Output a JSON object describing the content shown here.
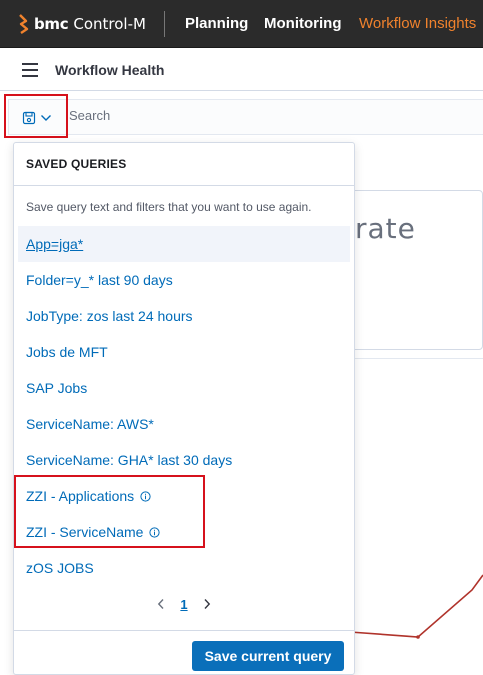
{
  "topbar": {
    "brand_name": "bmc",
    "product_name": "Control-M",
    "nav_items": [
      "Planning",
      "Monitoring",
      "Workflow Insights"
    ],
    "active_nav": "Workflow Insights",
    "accent_color": "#f0822d"
  },
  "header": {
    "title": "Workflow Health",
    "menu_icon": "hamburger-icon"
  },
  "search": {
    "placeholder": "Search",
    "query_menu_icon": "save-query-icon"
  },
  "background": {
    "panel_text": "rate"
  },
  "saved_queries": {
    "title": "SAVED QUERIES",
    "description": "Save query text and filters that you want to use again.",
    "items": [
      {
        "label": "App=jga*",
        "selected": true,
        "info": false
      },
      {
        "label": "Folder=y_* last 90 days",
        "selected": false,
        "info": false
      },
      {
        "label": "JobType: zos last 24 hours",
        "selected": false,
        "info": false
      },
      {
        "label": "Jobs de MFT",
        "selected": false,
        "info": false
      },
      {
        "label": "SAP Jobs",
        "selected": false,
        "info": false
      },
      {
        "label": "ServiceName: AWS*",
        "selected": false,
        "info": false
      },
      {
        "label": "ServiceName: GHA* last 30 days",
        "selected": false,
        "info": false
      },
      {
        "label": "ZZI - Applications",
        "selected": false,
        "info": true
      },
      {
        "label": "ZZI - ServiceName",
        "selected": false,
        "info": true
      },
      {
        "label": "zOS JOBS",
        "selected": false,
        "info": false
      }
    ],
    "pagination": {
      "current_page": "1"
    },
    "save_button_label": "Save current query",
    "link_color": "#006bb8",
    "button_color": "#0a6fba",
    "highlight_color": "#d6111c"
  }
}
